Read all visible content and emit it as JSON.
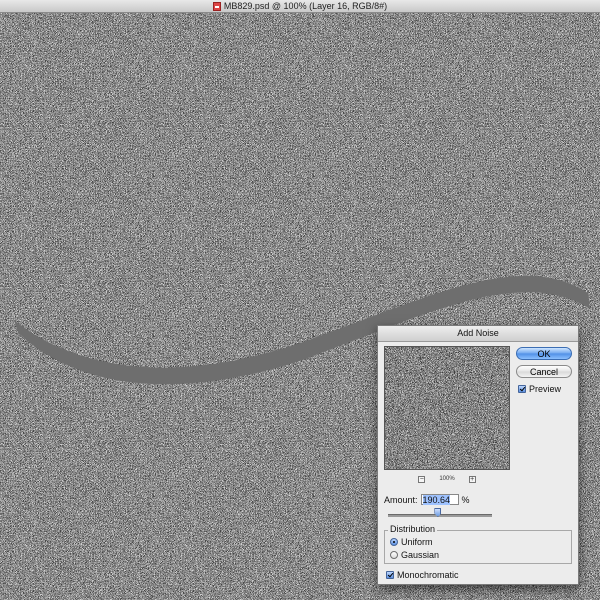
{
  "window": {
    "title": "MB829.psd @ 100% (Layer 16, RGB/8#)",
    "file_icon": "psd-document-icon"
  },
  "dialog": {
    "title": "Add Noise",
    "ok_label": "OK",
    "cancel_label": "Cancel",
    "preview_label": "Preview",
    "preview_checked": true,
    "zoom_minus": "−",
    "zoom_level": "100%",
    "zoom_plus": "+",
    "amount_label": "Amount:",
    "amount_value": "190.64",
    "amount_unit": "%",
    "amount_slider_fraction": 0.48,
    "distribution_label": "Distribution",
    "distribution_options": [
      "Uniform",
      "Gaussian"
    ],
    "distribution_selected": "Uniform",
    "monochromatic_label": "Monochromatic",
    "monochromatic_checked": true
  },
  "colors": {
    "accent": "#5b8fe0",
    "curve": "#6e6e6e"
  }
}
